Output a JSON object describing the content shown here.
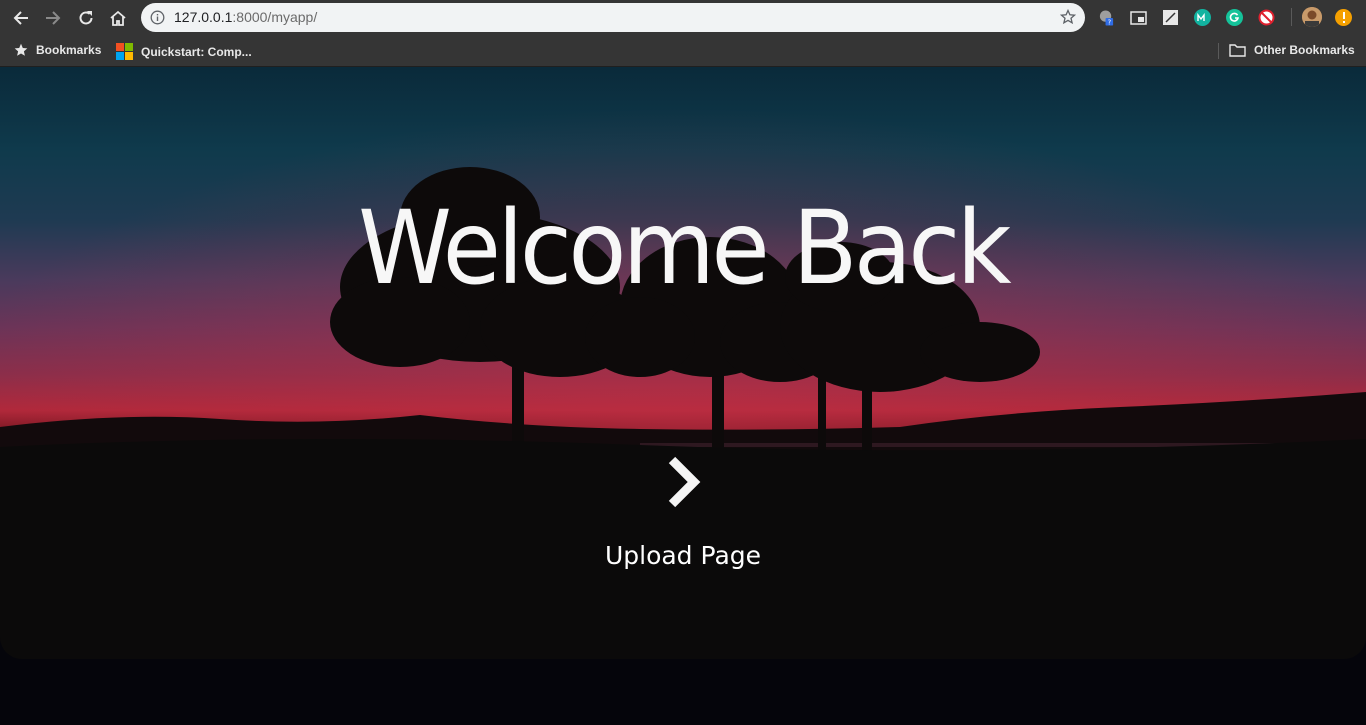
{
  "browser": {
    "url_host": "127.0.0.1",
    "url_rest": ":8000/myapp/",
    "bookmarks": {
      "items": [
        {
          "label": "Bookmarks",
          "icon": "star-icon"
        },
        {
          "label": "Quickstart: Comp...",
          "icon": "microsoft-logo-icon"
        }
      ],
      "other_label": "Other Bookmarks"
    },
    "extensions": [
      {
        "name": "help-extension-icon",
        "color": "#9e9e9e"
      },
      {
        "name": "picture-in-picture-icon",
        "color": "#e8e8e8"
      },
      {
        "name": "cast-extension-icon",
        "color": "#e8e8e8"
      },
      {
        "name": "m-extension-icon",
        "color": "#12b3a0"
      },
      {
        "name": "grammarly-icon",
        "color": "#15c39a"
      },
      {
        "name": "block-extension-icon",
        "color": "#e0202e"
      },
      {
        "name": "profile-avatar-icon",
        "color": "#b07a4a"
      },
      {
        "name": "alert-extension-icon",
        "color": "#f5a000"
      }
    ]
  },
  "hero": {
    "headline": "Welcome Back",
    "link_label": "Upload Page",
    "next_icon": "chevron-right-icon"
  }
}
